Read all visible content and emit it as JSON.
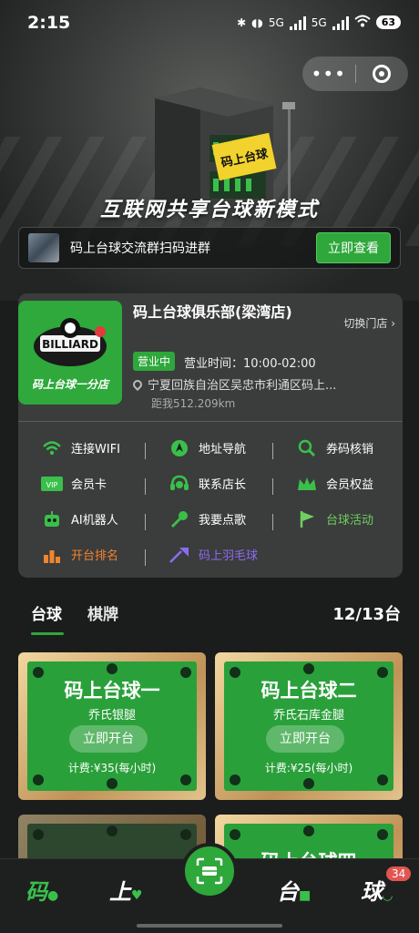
{
  "status_bar": {
    "time": "2:15",
    "net1": "5G",
    "net2": "5G",
    "battery": "63"
  },
  "hero": {
    "sign_text": "码上台球",
    "title": "互联网共享台球新模式"
  },
  "group_banner": {
    "text": "码上台球交流群扫码进群",
    "button": "立即查看"
  },
  "store": {
    "logo_text": "码上台球一分店",
    "logo_badge": "BILLIARD",
    "name": "码上台球俱乐部(梁湾店)",
    "switch_label": "切换门店",
    "status": "营业中",
    "hours": "营业时间：10:00-02:00",
    "address": "宁夏回族自治区吴忠市利通区码上...",
    "distance": "距我512.209km",
    "features": [
      [
        {
          "label": "连接WIFI",
          "icon": "wifi-icon"
        },
        {
          "label": "地址导航",
          "icon": "navigation-icon"
        },
        {
          "label": "券码核销",
          "icon": "coupon-verify-icon"
        }
      ],
      [
        {
          "label": "会员卡",
          "icon": "vip-card-icon"
        },
        {
          "label": "联系店长",
          "icon": "headset-icon"
        },
        {
          "label": "会员权益",
          "icon": "crown-icon"
        }
      ],
      [
        {
          "label": "AI机器人",
          "icon": "robot-icon"
        },
        {
          "label": "我要点歌",
          "icon": "microphone-icon"
        },
        {
          "label": "台球活动",
          "icon": "flag-icon"
        }
      ],
      [
        {
          "label": "开台排名",
          "icon": "ranking-icon"
        },
        {
          "label": "码上羽毛球",
          "icon": "badminton-icon"
        }
      ]
    ]
  },
  "tabs": [
    {
      "label": "台球"
    },
    {
      "label": "棋牌"
    }
  ],
  "table_count": "12/13台",
  "tables": [
    {
      "name": "码上台球一",
      "sub": "乔氏银腿",
      "button": "立即开台",
      "price": "计费:¥35(每小时)"
    },
    {
      "name": "码上台球二",
      "sub": "乔氏石库金腿",
      "button": "立即开台",
      "price": "计费:¥25(每小时)"
    },
    {
      "name": "码上台球四"
    }
  ],
  "bottom_nav": {
    "item1": "码",
    "item2": "上",
    "item3": "台",
    "item4": "球",
    "badge": "34"
  },
  "colors": {
    "accent": "#2ea73b",
    "activity": "#6fd05e",
    "ranking": "#f0852d",
    "badminton": "#8b6cf0"
  }
}
